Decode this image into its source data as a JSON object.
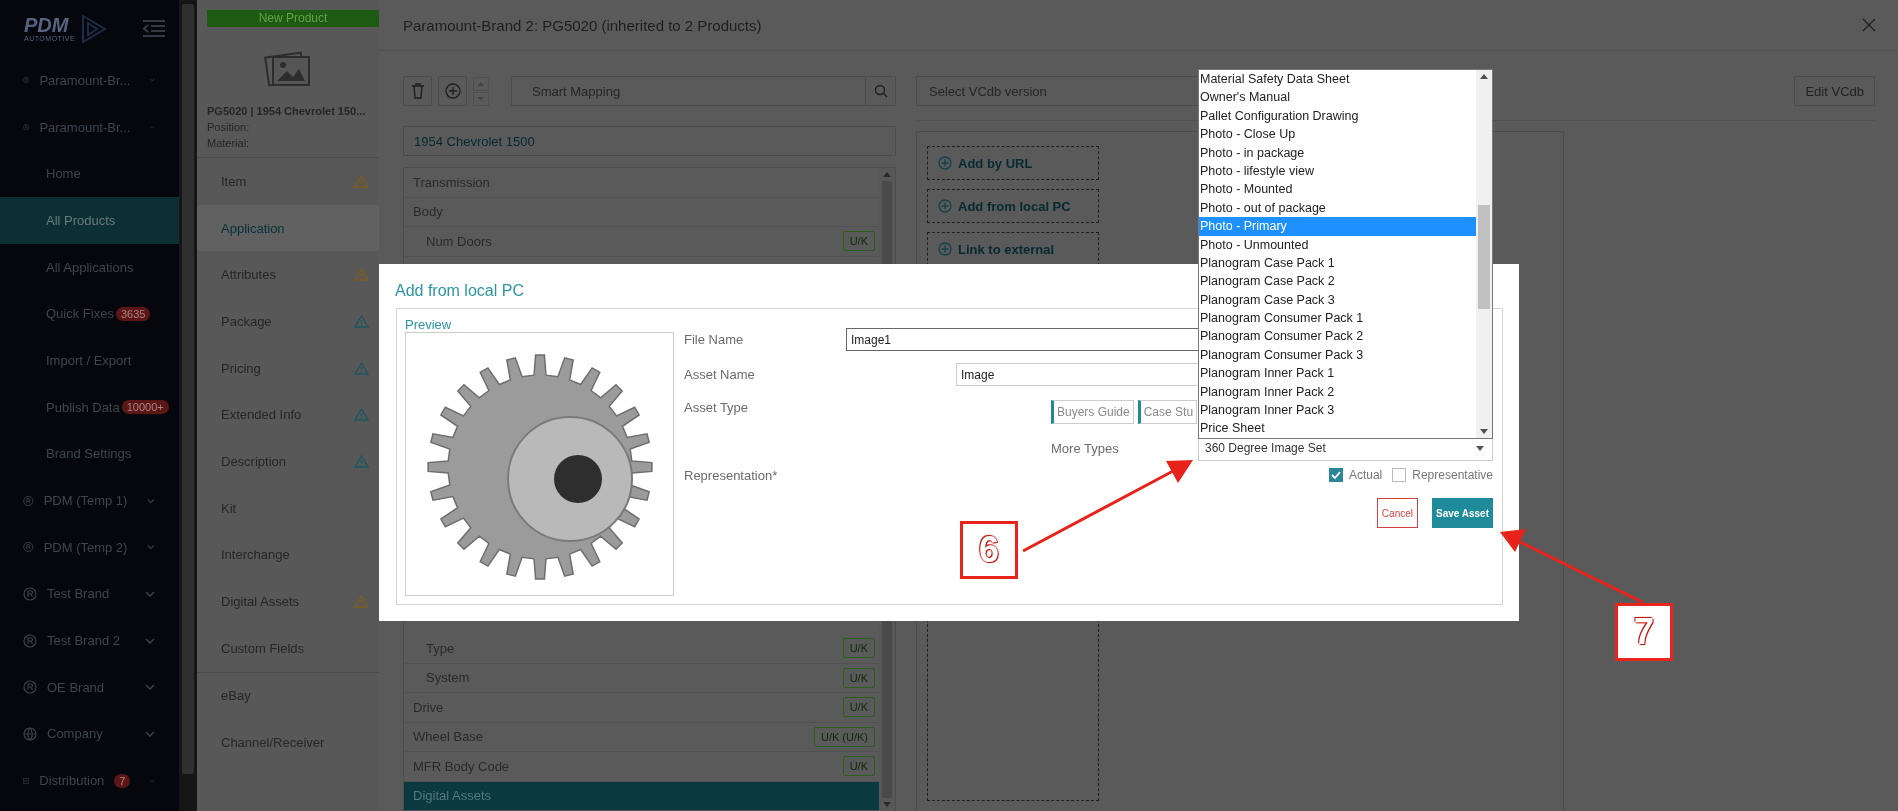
{
  "sidebar": {
    "logo": {
      "name": "PDM",
      "tagline": "AUTOMOTIVE"
    },
    "items": [
      {
        "kind": "brand",
        "label": "Paramount-Br...",
        "expanded": false
      },
      {
        "kind": "brand",
        "label": "Paramount-Br...",
        "expanded": true,
        "children": [
          {
            "label": "Home",
            "selected": false
          },
          {
            "label": "All Products",
            "selected": true
          },
          {
            "label": "All Applications",
            "selected": false
          },
          {
            "label": "Quick Fixes",
            "selected": false,
            "badge": "3635"
          },
          {
            "label": "Import / Export",
            "selected": false
          },
          {
            "label": "Publish Data",
            "selected": false,
            "badge": "10000+"
          },
          {
            "label": "Brand Settings",
            "selected": false
          }
        ]
      },
      {
        "kind": "brand",
        "label": "PDM (Temp 1)",
        "expanded": false
      },
      {
        "kind": "brand",
        "label": "PDM (Temp 2)",
        "expanded": false
      },
      {
        "kind": "brand",
        "label": "Test Brand",
        "expanded": false
      },
      {
        "kind": "brand",
        "label": "Test Brand 2",
        "expanded": false
      },
      {
        "kind": "brand",
        "label": "OE Brand",
        "expanded": false
      },
      {
        "kind": "globe",
        "label": "Company",
        "expanded": false
      },
      {
        "kind": "box",
        "label": "Distribution",
        "expanded": false,
        "badge": "7"
      }
    ]
  },
  "product": {
    "new_button": "New Product",
    "title": "PG5020 | 1954 Chevrolet 150...",
    "details": [
      "Position:",
      "Material:"
    ],
    "tabs": [
      {
        "label": "Item",
        "selected": false,
        "color": "#7a5c1e"
      },
      {
        "label": "Application",
        "selected": true
      },
      {
        "label": "Attributes",
        "selected": false,
        "color": "#7a5c1e"
      },
      {
        "label": "Package",
        "selected": false,
        "color": "#1d5862"
      },
      {
        "label": "Pricing",
        "selected": false,
        "color": "#1d5862"
      },
      {
        "label": "Extended Info",
        "selected": false,
        "color": "#1d5862"
      },
      {
        "label": "Description",
        "selected": false,
        "color": "#1d5862"
      },
      {
        "label": "Kit",
        "selected": false
      },
      {
        "label": "Interchange",
        "selected": false
      },
      {
        "label": "Digital Assets",
        "selected": false,
        "color": "#7a5c1e"
      },
      {
        "label": "Custom Fields",
        "selected": false
      }
    ],
    "channel_tabs": [
      {
        "label": "eBay",
        "selected": false
      },
      {
        "label": "Channel/Receiver",
        "selected": false
      }
    ]
  },
  "dialog": {
    "title": "Paramount-Brand 2: PG5020 (inherited to 2 Products)",
    "smart_mapping": {
      "placeholder": "Smart Mapping"
    },
    "vcdb": {
      "placeholder": "Select VCdb version"
    },
    "edit_button": "Edit VCdb",
    "vehicle": "1954 Chevrolet 1500",
    "tree_top": [
      {
        "label": "Transmission",
        "selected": false
      },
      {
        "label": "Body",
        "selected": false,
        "children": [
          {
            "label": "Num Doors",
            "value": "U/K",
            "selected": false
          }
        ]
      }
    ],
    "tree_bottom": [
      {
        "children": [
          {
            "label": "Type",
            "value": "U/K",
            "selected": false
          },
          {
            "label": "System",
            "value": "U/K",
            "selected": false
          }
        ]
      },
      {
        "label": "Drive",
        "value": "U/K",
        "selected": false
      },
      {
        "label": "Wheel Base",
        "value": "U/K (U/K)",
        "selected": false
      },
      {
        "label": "MFR Body Code",
        "value": "U/K",
        "selected": false
      },
      {
        "label": "Digital Assets",
        "selected": true
      }
    ],
    "asset_actions": [
      "Add by URL",
      "Add from local PC",
      "Link to external"
    ]
  },
  "modal": {
    "title": "Add from local PC",
    "preview_label": "Preview",
    "file_name": {
      "label": "File Name",
      "value": "Image1"
    },
    "asset_name": {
      "label": "Asset Name",
      "value": "Image"
    },
    "asset_type": {
      "label": "Asset Type",
      "chips": [
        "Buyers Guide",
        "Case Stu"
      ]
    },
    "more_types": {
      "label": "More Types",
      "value": "360 Degree Image Set"
    },
    "representation": {
      "label": "Representation*",
      "options": [
        {
          "label": "Actual",
          "checked": true
        },
        {
          "label": "Representative",
          "checked": false
        }
      ]
    },
    "cancel": "Cancel",
    "save": "Save Asset"
  },
  "dropdown": {
    "options": [
      {
        "label": "Material Safety Data Sheet",
        "selected": false
      },
      {
        "label": "Owner's Manual",
        "selected": false
      },
      {
        "label": "Pallet Configuration Drawing",
        "selected": false
      },
      {
        "label": "Photo - Close Up",
        "selected": false
      },
      {
        "label": "Photo - in package",
        "selected": false
      },
      {
        "label": "Photo - lifestyle view",
        "selected": false
      },
      {
        "label": "Photo - Mounted",
        "selected": false
      },
      {
        "label": "Photo - out of package",
        "selected": false
      },
      {
        "label": "Photo - Primary",
        "selected": true
      },
      {
        "label": "Photo - Unmounted",
        "selected": false
      },
      {
        "label": "Planogram Case Pack 1",
        "selected": false
      },
      {
        "label": "Planogram Case Pack 2",
        "selected": false
      },
      {
        "label": "Planogram Case Pack 3",
        "selected": false
      },
      {
        "label": "Planogram Consumer Pack 1",
        "selected": false
      },
      {
        "label": "Planogram Consumer Pack 2",
        "selected": false
      },
      {
        "label": "Planogram Consumer Pack 3",
        "selected": false
      },
      {
        "label": "Planogram Inner Pack 1",
        "selected": false
      },
      {
        "label": "Planogram Inner Pack 2",
        "selected": false
      },
      {
        "label": "Planogram Inner Pack 3",
        "selected": false
      },
      {
        "label": "Price Sheet",
        "selected": false
      }
    ]
  },
  "callouts": [
    {
      "number": "6"
    },
    {
      "number": "7"
    }
  ]
}
